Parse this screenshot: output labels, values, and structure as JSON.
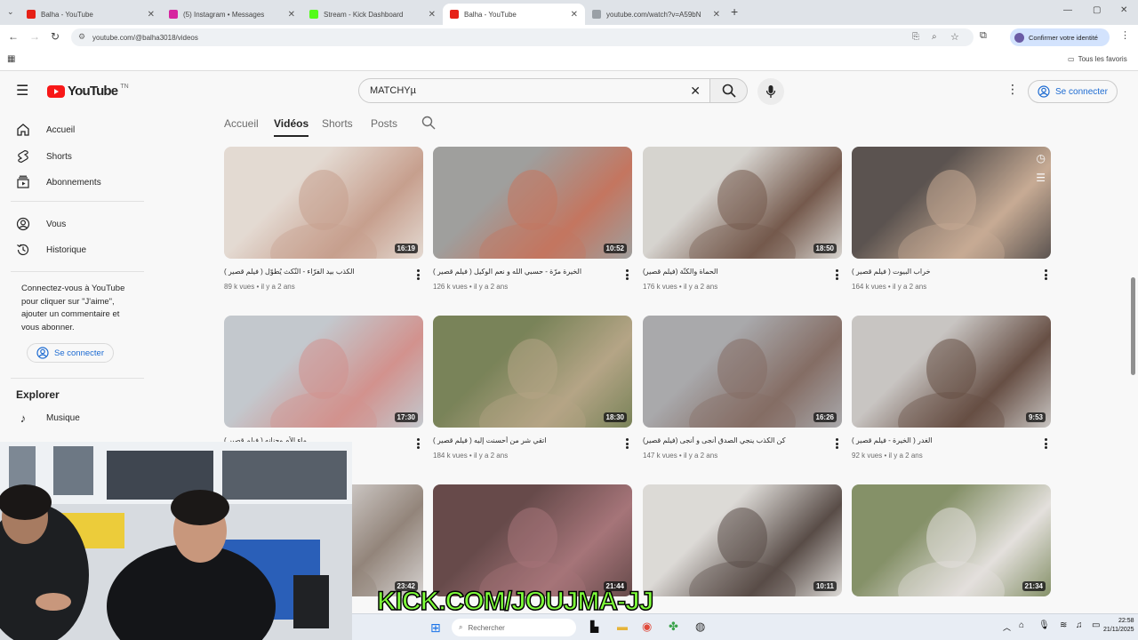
{
  "browser": {
    "tabs": [
      {
        "title": "Balha - YouTube",
        "color": "#e62117",
        "active": false
      },
      {
        "title": "(5) Instagram • Messages",
        "color": "#d6249f",
        "active": false
      },
      {
        "title": "Stream - Kick Dashboard",
        "color": "#53fc18",
        "active": false
      },
      {
        "title": "Balha - YouTube",
        "color": "#e62117",
        "active": true
      },
      {
        "title": "youtube.com/watch?v=A59bN",
        "color": "#9aa0a6",
        "active": false
      }
    ],
    "url": "youtube.com/@balha3018/videos",
    "profile_label": "Confirmer votre identité",
    "bookmarks_label": "Tous les favoris"
  },
  "youtube": {
    "logo_text": "YouTube",
    "logo_region": "TN",
    "search_value": "MATCHYµ",
    "signin_label": "Se connecter"
  },
  "sidebar": {
    "items": [
      {
        "label": "Accueil",
        "icon": "home-icon"
      },
      {
        "label": "Shorts",
        "icon": "shorts-icon"
      },
      {
        "label": "Abonnements",
        "icon": "subscriptions-icon"
      },
      {
        "label": "Vous",
        "icon": "user-icon"
      },
      {
        "label": "Historique",
        "icon": "history-icon"
      }
    ],
    "signin_prompt": "Connectez-vous à YouTube pour cliquer sur \"J'aime\", ajouter un commentaire et vous abonner.",
    "signin_label": "Se connecter",
    "explore_heading": "Explorer",
    "explore_items": [
      {
        "label": "Musique",
        "icon": "music-icon"
      }
    ]
  },
  "channel_tabs": [
    "Accueil",
    "Vidéos",
    "Shorts",
    "Posts"
  ],
  "active_tab": "Vidéos",
  "videos": [
    {
      "title": "الكذب بيد الفرّاء - النّكث يُطوّل ( فيلم قصير )",
      "views": "89 k vues",
      "age": "il y a 2 ans",
      "duration": "16:19",
      "palette": [
        "#e8ddd4",
        "#c79a86"
      ]
    },
    {
      "title": "الخيرة مرّة - حسبي الله و نعم الوكيل ( فيلم قصير )",
      "views": "126 k vues",
      "age": "il y a 2 ans",
      "duration": "10:52",
      "palette": [
        "#9a9a98",
        "#c46b52"
      ]
    },
    {
      "title": "الحماة والكنّة (فيلم قصير)",
      "views": "176 k vues",
      "age": "il y a 2 ans",
      "duration": "18:50",
      "palette": [
        "#d9d6d1",
        "#6a4b3c"
      ]
    },
    {
      "title": "خراب البيوت ( فيلم قصير )",
      "views": "164 k vues",
      "age": "il y a 2 ans",
      "duration": "",
      "palette": [
        "#4d4440",
        "#c8a88e"
      ]
    },
    {
      "title": "ماء الأم وحنانه ( فيلم قصير )",
      "views": "",
      "age": "",
      "duration": "17:30",
      "palette": [
        "#c3c9cf",
        "#d48b86"
      ]
    },
    {
      "title": "اتقي شر من أحسنت إليه ( فيلم قصير )",
      "views": "184 k vues",
      "age": "il y a 2 ans",
      "duration": "18:30",
      "palette": [
        "#6f7a4a",
        "#b3a17e"
      ]
    },
    {
      "title": "كن الكذب ينجي الصدق أنجى و أنجى (فيلم قصير)",
      "views": "147 k vues",
      "age": "il y a 2 ans",
      "duration": "16:26",
      "palette": [
        "#a5a5a8",
        "#7c6157"
      ]
    },
    {
      "title": "الغدر ( الخيرة - فيلم قصير )",
      "views": "92 k vues",
      "age": "il y a 2 ans",
      "duration": "9:53",
      "palette": [
        "#c9c5c2",
        "#5a3f33"
      ]
    },
    {
      "title": "",
      "views": "",
      "age": "",
      "duration": "23:42",
      "palette": [
        "#d8d4d2",
        "#8c7c70"
      ]
    },
    {
      "title": "",
      "views": "",
      "age": "",
      "duration": "21:44",
      "palette": [
        "#5a3a3a",
        "#a26a6f"
      ]
    },
    {
      "title": "",
      "views": "",
      "age": "",
      "duration": "10:11",
      "palette": [
        "#e0ddd9",
        "#4a3c36"
      ]
    },
    {
      "title": "",
      "views": "",
      "age": "",
      "duration": "21:34",
      "palette": [
        "#7d8a5c",
        "#e8e4e0"
      ]
    }
  ],
  "overlay": {
    "kick_text": "KICK.COM/JOUJMA-JJ"
  },
  "taskbar": {
    "search_placeholder": "Rechercher",
    "time": "22:58",
    "date": "21/11/2025"
  }
}
